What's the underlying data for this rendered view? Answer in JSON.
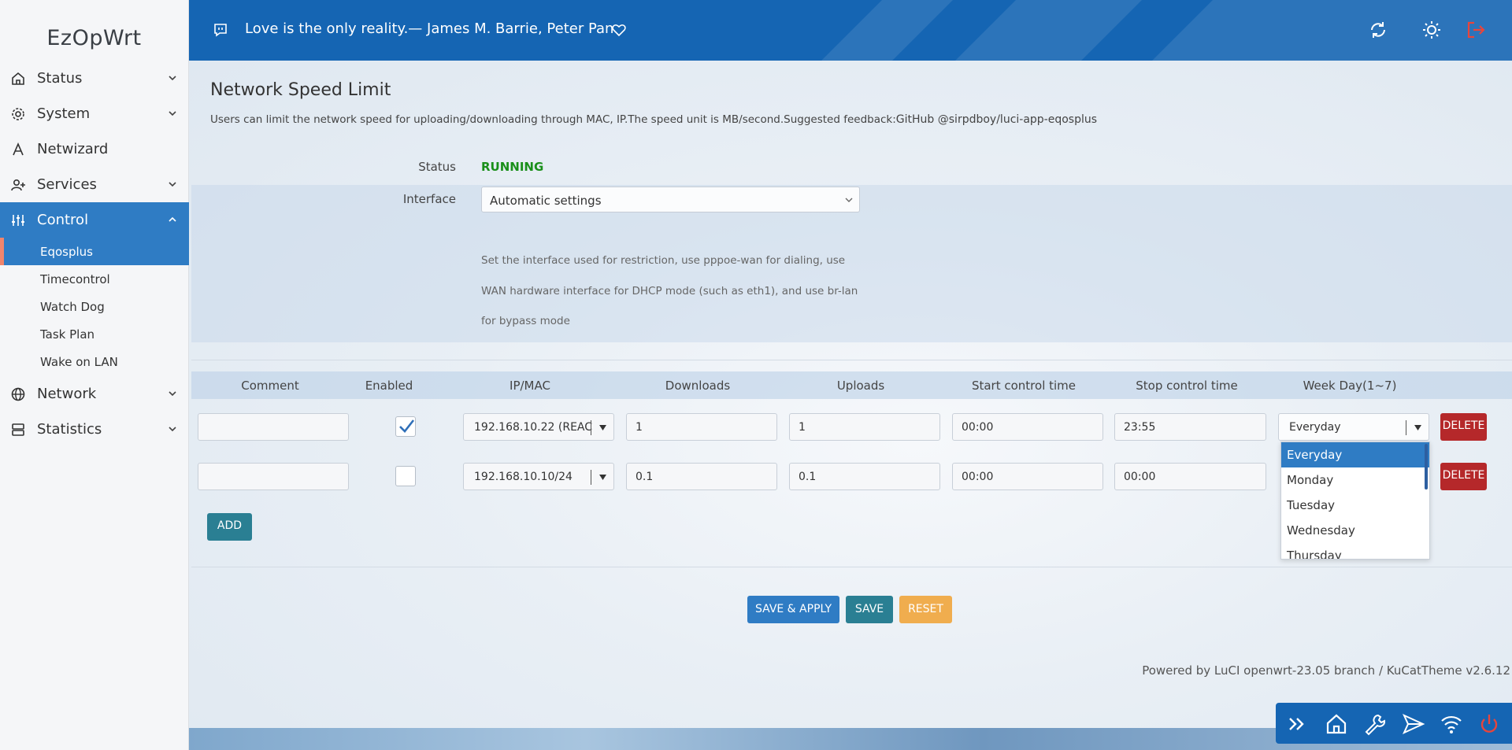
{
  "brand": "EzOpWrt",
  "sidebar": {
    "items": [
      {
        "label": "Status",
        "icon": "home-icon"
      },
      {
        "label": "System",
        "icon": "gear-icon"
      },
      {
        "label": "Netwizard",
        "icon": "wizard-icon"
      },
      {
        "label": "Services",
        "icon": "user-plus-icon"
      },
      {
        "label": "Control",
        "icon": "sliders-icon"
      },
      {
        "label": "Network",
        "icon": "globe-icon"
      },
      {
        "label": "Statistics",
        "icon": "server-icon"
      }
    ],
    "control_sub": [
      "Eqosplus",
      "Timecontrol",
      "Watch Dog",
      "Task Plan",
      "Wake on LAN"
    ]
  },
  "header": {
    "quote": "Love is the only reality.— James M. Barrie, Peter Pan"
  },
  "page": {
    "title": "Network Speed Limit",
    "description": "Users can limit the network speed for uploading/downloading through MAC, IP.The speed unit is MB/second.Suggested feedback:",
    "feedback_link": "GitHub @sirpdboy/luci-app-eqosplus",
    "status_label": "Status",
    "status_value": "RUNNING",
    "interface_label": "Interface",
    "interface_value": "Automatic settings",
    "interface_help": [
      "Set the interface used for restriction, use pppoe-wan for dialing, use",
      "WAN hardware interface for DHCP mode (such as eth1), and use br-lan",
      "for bypass mode"
    ]
  },
  "table": {
    "headers": [
      "Comment",
      "Enabled",
      "IP/MAC",
      "Downloads",
      "Uploads",
      "Start control time",
      "Stop control time",
      "Week Day(1~7)"
    ],
    "rows": [
      {
        "comment": "",
        "enabled": true,
        "ipmac": "192.168.10.22 (REAC",
        "downloads": "1",
        "uploads": "1",
        "start": "00:00",
        "stop": "23:55",
        "weekday": "Everyday"
      },
      {
        "comment": "",
        "enabled": false,
        "ipmac": "192.168.10.10/24",
        "downloads": "0.1",
        "uploads": "0.1",
        "start": "00:00",
        "stop": "00:00",
        "weekday": ""
      }
    ],
    "delete_label": "DELETE",
    "add_label": "ADD"
  },
  "weekday_options": [
    "Everyday",
    "Monday",
    "Tuesday",
    "Wednesday",
    "Thursday"
  ],
  "actions": {
    "save_apply": "SAVE & APPLY",
    "save": "SAVE",
    "reset": "RESET"
  },
  "footer": "Powered by LuCI openwrt-23.05 branch / KuCatTheme v2.6.12",
  "colors": {
    "primary": "#1565b3",
    "active": "#2f7cc4",
    "delete": "#b5282a",
    "add": "#2a7f93",
    "reset": "#f0ad4e",
    "running": "#1a8f1a",
    "accent": "#f0856d"
  }
}
